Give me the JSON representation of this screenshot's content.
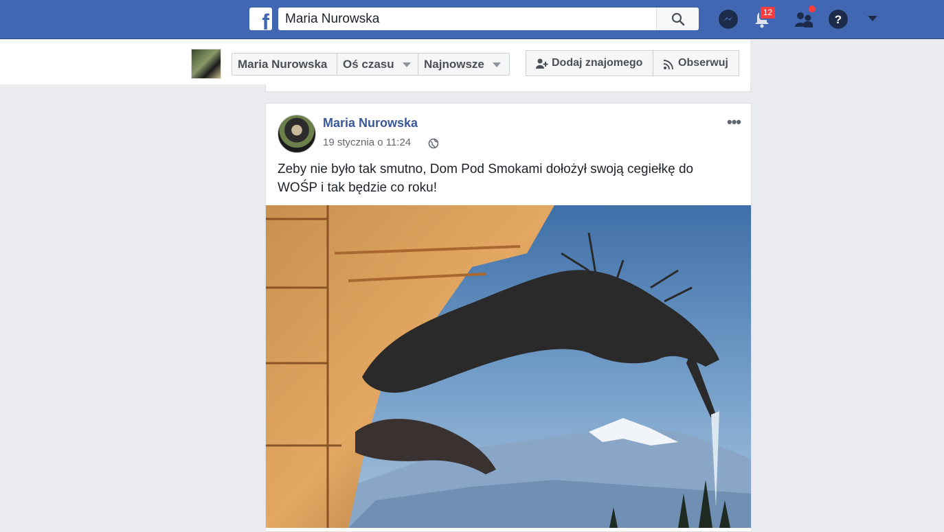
{
  "app": {
    "logo_letter": "f",
    "accent": "#4267b2",
    "search_value": "Maria Nurowska",
    "notifications_count": "12",
    "icons": [
      "search-icon",
      "messenger-icon",
      "notifications-icon",
      "friend-requests-icon",
      "help-icon",
      "account-menu-icon"
    ]
  },
  "profile_bar": {
    "name": "Maria Nurowska",
    "timeline_label": "Oś czasu",
    "sort_label": "Najnowsze",
    "add_friend_label": "Dodaj znajomego",
    "follow_label": "Obserwuj"
  },
  "post": {
    "author": "Maria Nurowska",
    "timestamp": "19 stycznia o 11:24",
    "privacy_icon": "globe-icon",
    "text": "Zeby nie było tak smutno, Dom Pod Smokami dołożył swoją cegiełkę do WOŚP i tak będzie co roku!",
    "more_label": "•••"
  }
}
